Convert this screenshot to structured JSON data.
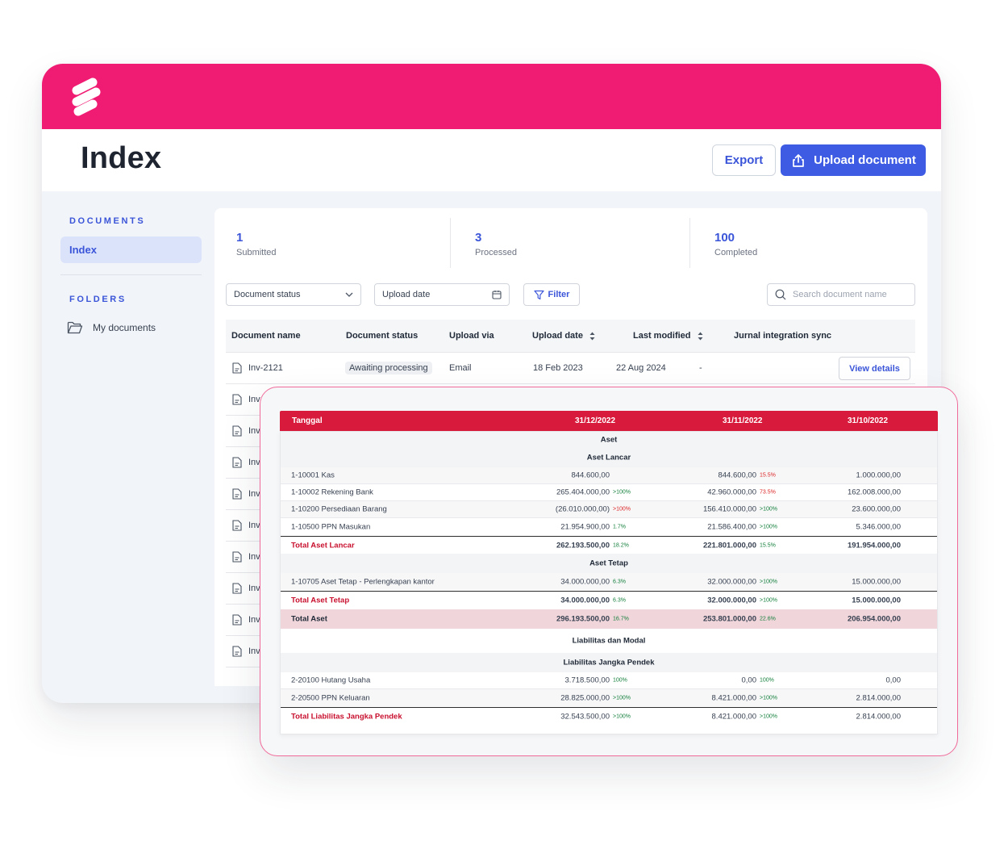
{
  "app": {
    "title": "Index",
    "export_label": "Export",
    "upload_label": "Upload document",
    "brand_color": "#f01c73",
    "accent_color": "#3d5be3"
  },
  "sidebar": {
    "documents_heading": "DOCUMENTS",
    "active_item": "Index",
    "folders_heading": "FOLDERS",
    "folder_item": "My documents"
  },
  "stats": [
    {
      "value": "1",
      "label": "Submitted"
    },
    {
      "value": "3",
      "label": "Processed"
    },
    {
      "value": "100",
      "label": "Completed"
    }
  ],
  "filters": {
    "status_label": "Document status",
    "date_label": "Upload date",
    "filter_label": "Filter",
    "search_placeholder": "Search document name"
  },
  "table": {
    "headers": [
      "Document name",
      "Document status",
      "Upload via",
      "Upload date",
      "Last modified",
      "Jurnal integration sync"
    ],
    "first_row": {
      "name": "Inv-2121",
      "status": "Awaiting processing",
      "via": "Email",
      "upload_date": "18 Feb 2023",
      "modified": "22 Aug 2024",
      "sync": "-",
      "action": "View details"
    },
    "truncated_rows": [
      "Inv",
      "Inv",
      "Inv",
      "Inv",
      "Inv",
      "Inv",
      "Inv",
      "Inv",
      "Inv"
    ]
  },
  "report": {
    "header": {
      "label": "Tanggal",
      "col1": "31/12/2022",
      "col2": "31/11/2022",
      "col3": "31/10/2022"
    },
    "section_aset": "Aset",
    "section_aset_lancar": "Aset Lancar",
    "kas": {
      "label": "1-10001 Kas",
      "c1": "844.600,00",
      "c2": "844.600,00",
      "c2p": "15.5%",
      "c3": "1.000.000,00"
    },
    "bank": {
      "label": "1-10002 Rekening Bank",
      "c1": "265.404.000,00",
      "c1p": ">100%",
      "c2": "42.960.000,00",
      "c2p": "73.5%",
      "c3": "162.008.000,00"
    },
    "persediaan": {
      "label": "1-10200 Persediaan Barang",
      "c1": "(26.010.000,00)",
      "c1p": ">100%",
      "c2": "156.410.000,00",
      "c2p": ">100%",
      "c3": "23.600.000,00"
    },
    "ppn_masukan": {
      "label": "1-10500 PPN Masukan",
      "c1": "21.954.900,00",
      "c1p": "1.7%",
      "c2": "21.586.400,00",
      "c2p": ">100%",
      "c3": "5.346.000,00"
    },
    "total_aset_lancar": {
      "label": "Total Aset Lancar",
      "c1": "262.193.500,00",
      "c1p": "18.2%",
      "c2": "221.801.000,00",
      "c2p": "15.5%",
      "c3": "191.954.000,00"
    },
    "section_aset_tetap": "Aset Tetap",
    "aset_tetap": {
      "label": "1-10705 Aset Tetap - Perlengkapan kantor",
      "c1": "34.000.000,00",
      "c1p": "6.3%",
      "c2": "32.000.000,00",
      "c2p": ">100%",
      "c3": "15.000.000,00"
    },
    "total_aset_tetap": {
      "label": "Total Aset Tetap",
      "c1": "34.000.000,00",
      "c1p": "6.3%",
      "c2": "32.000.000,00",
      "c2p": ">100%",
      "c3": "15.000.000,00"
    },
    "total_aset": {
      "label": "Total Aset",
      "c1": "296.193.500,00",
      "c1p": "16.7%",
      "c2": "253.801.000,00",
      "c2p": "22.6%",
      "c3": "206.954.000,00"
    },
    "section_liabilitas": "Liabilitas dan Modal",
    "section_jangka_pendek": "Liabilitas Jangka Pendek",
    "hutang": {
      "label": "2-20100 Hutang Usaha",
      "c1": "3.718.500,00",
      "c1p": "100%",
      "c2": "0,00",
      "c2p": "100%",
      "c3": "0,00"
    },
    "ppn_keluaran": {
      "label": "2-20500 PPN Keluaran",
      "c1": "28.825.000,00",
      "c1p": ">100%",
      "c2": "8.421.000,00",
      "c2p": ">100%",
      "c3": "2.814.000,00"
    },
    "total_liabilitas": {
      "label": "Total Liabilitas Jangka Pendek",
      "c1": "32.543.500,00",
      "c1p": ">100%",
      "c2": "8.421.000,00",
      "c2p": ">100%",
      "c3": "2.814.000,00"
    }
  }
}
